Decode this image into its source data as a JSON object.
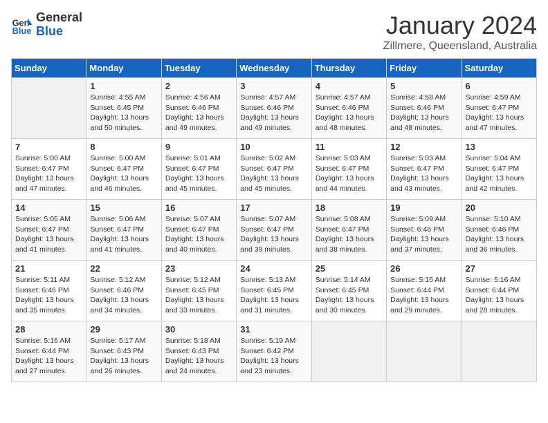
{
  "header": {
    "logo_general": "General",
    "logo_blue": "Blue",
    "month": "January 2024",
    "location": "Zillmere, Queensland, Australia"
  },
  "days_of_week": [
    "Sunday",
    "Monday",
    "Tuesday",
    "Wednesday",
    "Thursday",
    "Friday",
    "Saturday"
  ],
  "weeks": [
    [
      {
        "day": "",
        "info": ""
      },
      {
        "day": "1",
        "info": "Sunrise: 4:55 AM\nSunset: 6:45 PM\nDaylight: 13 hours\nand 50 minutes."
      },
      {
        "day": "2",
        "info": "Sunrise: 4:56 AM\nSunset: 6:46 PM\nDaylight: 13 hours\nand 49 minutes."
      },
      {
        "day": "3",
        "info": "Sunrise: 4:57 AM\nSunset: 6:46 PM\nDaylight: 13 hours\nand 49 minutes."
      },
      {
        "day": "4",
        "info": "Sunrise: 4:57 AM\nSunset: 6:46 PM\nDaylight: 13 hours\nand 48 minutes."
      },
      {
        "day": "5",
        "info": "Sunrise: 4:58 AM\nSunset: 6:46 PM\nDaylight: 13 hours\nand 48 minutes."
      },
      {
        "day": "6",
        "info": "Sunrise: 4:59 AM\nSunset: 6:47 PM\nDaylight: 13 hours\nand 47 minutes."
      }
    ],
    [
      {
        "day": "7",
        "info": "Sunrise: 5:00 AM\nSunset: 6:47 PM\nDaylight: 13 hours\nand 47 minutes."
      },
      {
        "day": "8",
        "info": "Sunrise: 5:00 AM\nSunset: 6:47 PM\nDaylight: 13 hours\nand 46 minutes."
      },
      {
        "day": "9",
        "info": "Sunrise: 5:01 AM\nSunset: 6:47 PM\nDaylight: 13 hours\nand 45 minutes."
      },
      {
        "day": "10",
        "info": "Sunrise: 5:02 AM\nSunset: 6:47 PM\nDaylight: 13 hours\nand 45 minutes."
      },
      {
        "day": "11",
        "info": "Sunrise: 5:03 AM\nSunset: 6:47 PM\nDaylight: 13 hours\nand 44 minutes."
      },
      {
        "day": "12",
        "info": "Sunrise: 5:03 AM\nSunset: 6:47 PM\nDaylight: 13 hours\nand 43 minutes."
      },
      {
        "day": "13",
        "info": "Sunrise: 5:04 AM\nSunset: 6:47 PM\nDaylight: 13 hours\nand 42 minutes."
      }
    ],
    [
      {
        "day": "14",
        "info": "Sunrise: 5:05 AM\nSunset: 6:47 PM\nDaylight: 13 hours\nand 41 minutes."
      },
      {
        "day": "15",
        "info": "Sunrise: 5:06 AM\nSunset: 6:47 PM\nDaylight: 13 hours\nand 41 minutes."
      },
      {
        "day": "16",
        "info": "Sunrise: 5:07 AM\nSunset: 6:47 PM\nDaylight: 13 hours\nand 40 minutes."
      },
      {
        "day": "17",
        "info": "Sunrise: 5:07 AM\nSunset: 6:47 PM\nDaylight: 13 hours\nand 39 minutes."
      },
      {
        "day": "18",
        "info": "Sunrise: 5:08 AM\nSunset: 6:47 PM\nDaylight: 13 hours\nand 38 minutes."
      },
      {
        "day": "19",
        "info": "Sunrise: 5:09 AM\nSunset: 6:46 PM\nDaylight: 13 hours\nand 37 minutes."
      },
      {
        "day": "20",
        "info": "Sunrise: 5:10 AM\nSunset: 6:46 PM\nDaylight: 13 hours\nand 36 minutes."
      }
    ],
    [
      {
        "day": "21",
        "info": "Sunrise: 5:11 AM\nSunset: 6:46 PM\nDaylight: 13 hours\nand 35 minutes."
      },
      {
        "day": "22",
        "info": "Sunrise: 5:12 AM\nSunset: 6:46 PM\nDaylight: 13 hours\nand 34 minutes."
      },
      {
        "day": "23",
        "info": "Sunrise: 5:12 AM\nSunset: 6:45 PM\nDaylight: 13 hours\nand 33 minutes."
      },
      {
        "day": "24",
        "info": "Sunrise: 5:13 AM\nSunset: 6:45 PM\nDaylight: 13 hours\nand 31 minutes."
      },
      {
        "day": "25",
        "info": "Sunrise: 5:14 AM\nSunset: 6:45 PM\nDaylight: 13 hours\nand 30 minutes."
      },
      {
        "day": "26",
        "info": "Sunrise: 5:15 AM\nSunset: 6:44 PM\nDaylight: 13 hours\nand 29 minutes."
      },
      {
        "day": "27",
        "info": "Sunrise: 5:16 AM\nSunset: 6:44 PM\nDaylight: 13 hours\nand 28 minutes."
      }
    ],
    [
      {
        "day": "28",
        "info": "Sunrise: 5:16 AM\nSunset: 6:44 PM\nDaylight: 13 hours\nand 27 minutes."
      },
      {
        "day": "29",
        "info": "Sunrise: 5:17 AM\nSunset: 6:43 PM\nDaylight: 13 hours\nand 26 minutes."
      },
      {
        "day": "30",
        "info": "Sunrise: 5:18 AM\nSunset: 6:43 PM\nDaylight: 13 hours\nand 24 minutes."
      },
      {
        "day": "31",
        "info": "Sunrise: 5:19 AM\nSunset: 6:42 PM\nDaylight: 13 hours\nand 23 minutes."
      },
      {
        "day": "",
        "info": ""
      },
      {
        "day": "",
        "info": ""
      },
      {
        "day": "",
        "info": ""
      }
    ]
  ]
}
